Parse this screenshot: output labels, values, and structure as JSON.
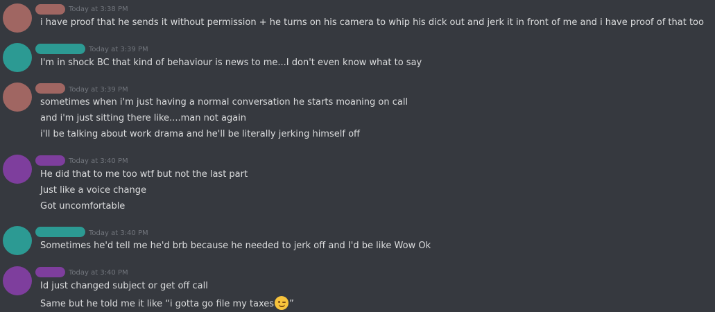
{
  "colors": {
    "background": "#36393f",
    "text": "#dcddde",
    "timestamp": "#72767d",
    "user_red": "#a06662",
    "user_teal": "#2c9a93",
    "user_purple": "#7e3e9d"
  },
  "messages": [
    {
      "timestamp": "Today at 3:38 PM",
      "lines": [
        "i have proof that he sends it without permission + he turns on his camera to whip his dick out and jerk it in front of me and i have proof of that too"
      ]
    },
    {
      "timestamp": "Today at 3:39 PM",
      "lines": [
        "I'm in shock BC that kind of behaviour is news to me...I don't even know what to say"
      ]
    },
    {
      "timestamp": "Today at 3:39 PM",
      "lines": [
        "sometimes when i'm just having a normal conversation he starts moaning on call",
        "and i'm just sitting there like....man not again",
        "i'll be talking about work drama and he'll be literally jerking himself off"
      ]
    },
    {
      "timestamp": "Today at 3:40 PM",
      "lines": [
        "He did that to me too wtf but not the last part",
        "Just like a voice change",
        "Got uncomfortable"
      ]
    },
    {
      "timestamp": "Today at 3:40 PM",
      "lines": [
        "Sometimes he'd tell me he'd brb because he needed to jerk off and I'd be like Wow Ok"
      ]
    },
    {
      "timestamp": "Today at 3:40 PM",
      "lines": [
        "Id just changed subject or get off call",
        "Same but he told me it like “i gotta go file my taxes",
        "”"
      ],
      "emoji": "winking-face-emoji"
    }
  ]
}
